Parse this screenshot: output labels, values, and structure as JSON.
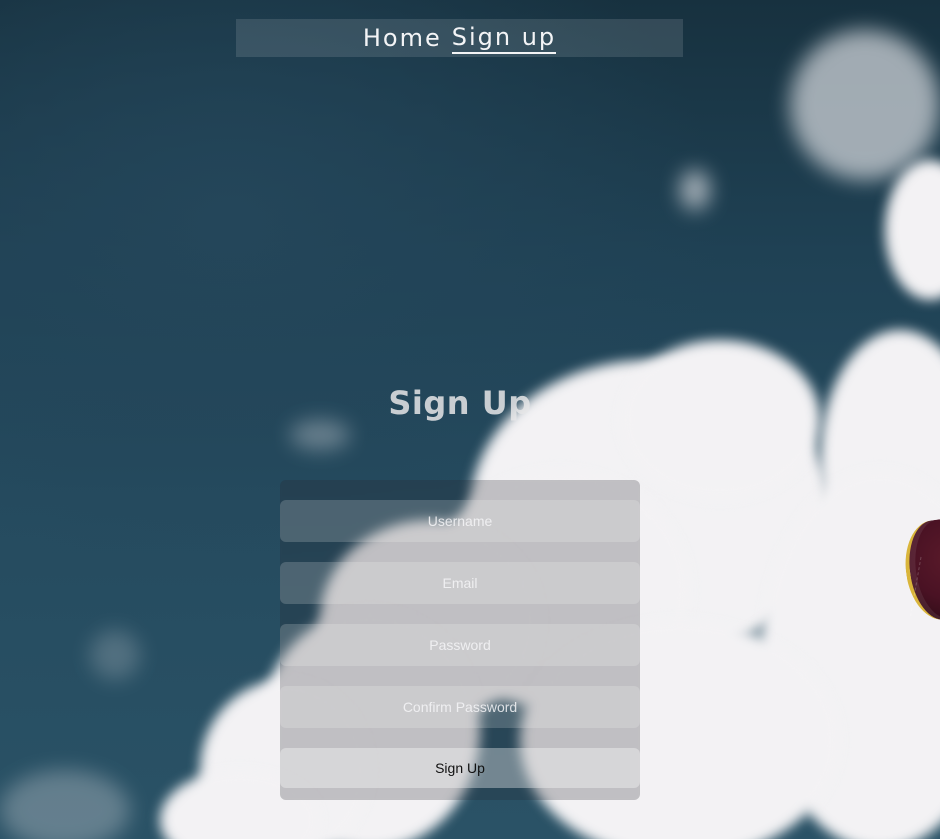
{
  "nav": {
    "home_label": "Home",
    "signup_label": "Sign up"
  },
  "page": {
    "title": "Sign Up"
  },
  "form": {
    "username_placeholder": "Username",
    "email_placeholder": "Email",
    "password_placeholder": "Password",
    "confirm_password_placeholder": "Confirm Password",
    "submit_label": "Sign Up"
  },
  "colors": {
    "sky_dark": "#17313f",
    "sky_mid": "#254b5f",
    "cloud": "#f3f2f4",
    "text_light": "#f3f4f6"
  }
}
